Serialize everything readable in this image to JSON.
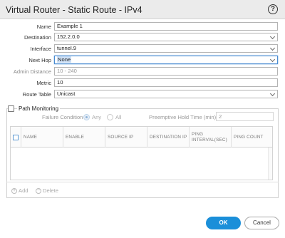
{
  "dialog": {
    "title": "Virtual Router - Static Route - IPv4",
    "help_symbol": "?"
  },
  "form": {
    "name": {
      "label": "Name",
      "value": "Example 1"
    },
    "destination": {
      "label": "Destination",
      "value": "152.2.0.0"
    },
    "interface": {
      "label": "Interface",
      "value": "tunnel.9"
    },
    "next_hop": {
      "label": "Next Hop",
      "value": "None"
    },
    "admin_distance": {
      "label": "Admin Distance",
      "placeholder": "10 - 240"
    },
    "metric": {
      "label": "Metric",
      "value": "10"
    },
    "route_table": {
      "label": "Route Table",
      "value": "Unicast"
    }
  },
  "path_monitoring": {
    "title": "Path Monitoring",
    "enabled": false,
    "failure_condition": {
      "label": "Failure Condition",
      "options": [
        "Any",
        "All"
      ],
      "selected": "Any"
    },
    "preemptive_hold_time": {
      "label": "Preemptive Hold Time (min)",
      "value": "2"
    },
    "table": {
      "columns": [
        "NAME",
        "ENABLE",
        "SOURCE IP",
        "DESTINATION IP",
        "PING INTERVAL(SEC)",
        "PING COUNT"
      ],
      "rows": []
    },
    "actions": {
      "add": "Add",
      "delete": "Delete"
    }
  },
  "buttons": {
    "ok": "OK",
    "cancel": "Cancel"
  },
  "colors": {
    "accent": "#1b8fd9",
    "focus": "#4a8cd2"
  }
}
